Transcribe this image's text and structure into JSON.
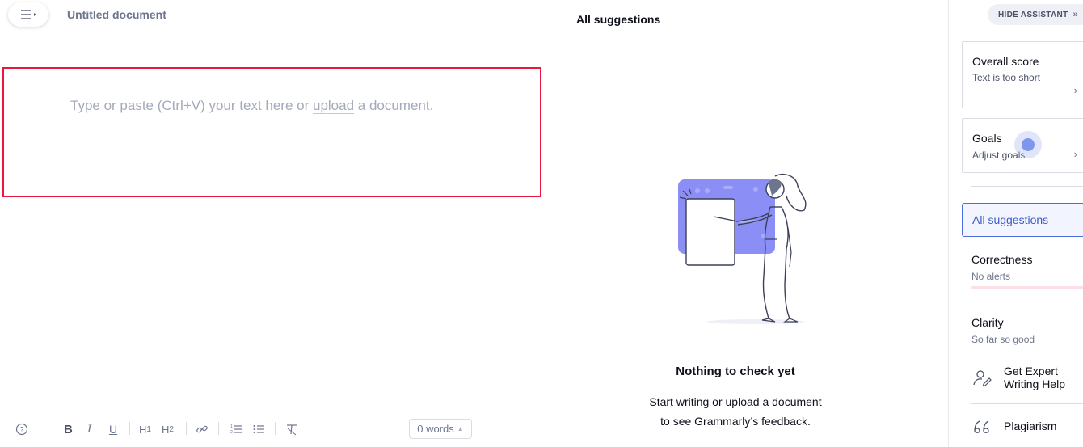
{
  "document": {
    "title": "Untitled document",
    "placeholder_before": "Type or paste (Ctrl+V) your text here or ",
    "placeholder_link": "upload",
    "placeholder_after": " a document."
  },
  "toolbar": {
    "help_icon": "help-icon",
    "items": [
      "bold",
      "italic",
      "underline",
      "heading-1",
      "heading-2",
      "link",
      "ordered-list",
      "unordered-list",
      "clear-formatting"
    ],
    "word_count": "0 words"
  },
  "suggestions": {
    "header": "All suggestions",
    "empty_title": "Nothing to check yet",
    "empty_line1": "Start writing or upload a document",
    "empty_line2": "to see Grammarly’s feedback."
  },
  "assistant": {
    "hide_label": "HIDE ASSISTANT",
    "overall": {
      "title": "Overall score",
      "subtitle": "Text is too short"
    },
    "goals": {
      "title": "Goals",
      "subtitle": "Adjust goals"
    },
    "all_suggestions": "All suggestions",
    "correctness": {
      "title": "Correctness",
      "subtitle": "No alerts"
    },
    "clarity": {
      "title": "Clarity",
      "subtitle": "So far so good"
    },
    "expert": {
      "line1": "Get Expert",
      "line2": "Writing Help"
    },
    "plagiarism": "Plagiarism"
  },
  "colors": {
    "accent": "#4a6ee0",
    "editor_outline": "#e8173b",
    "illustration_purple": "#8b8ef5"
  }
}
